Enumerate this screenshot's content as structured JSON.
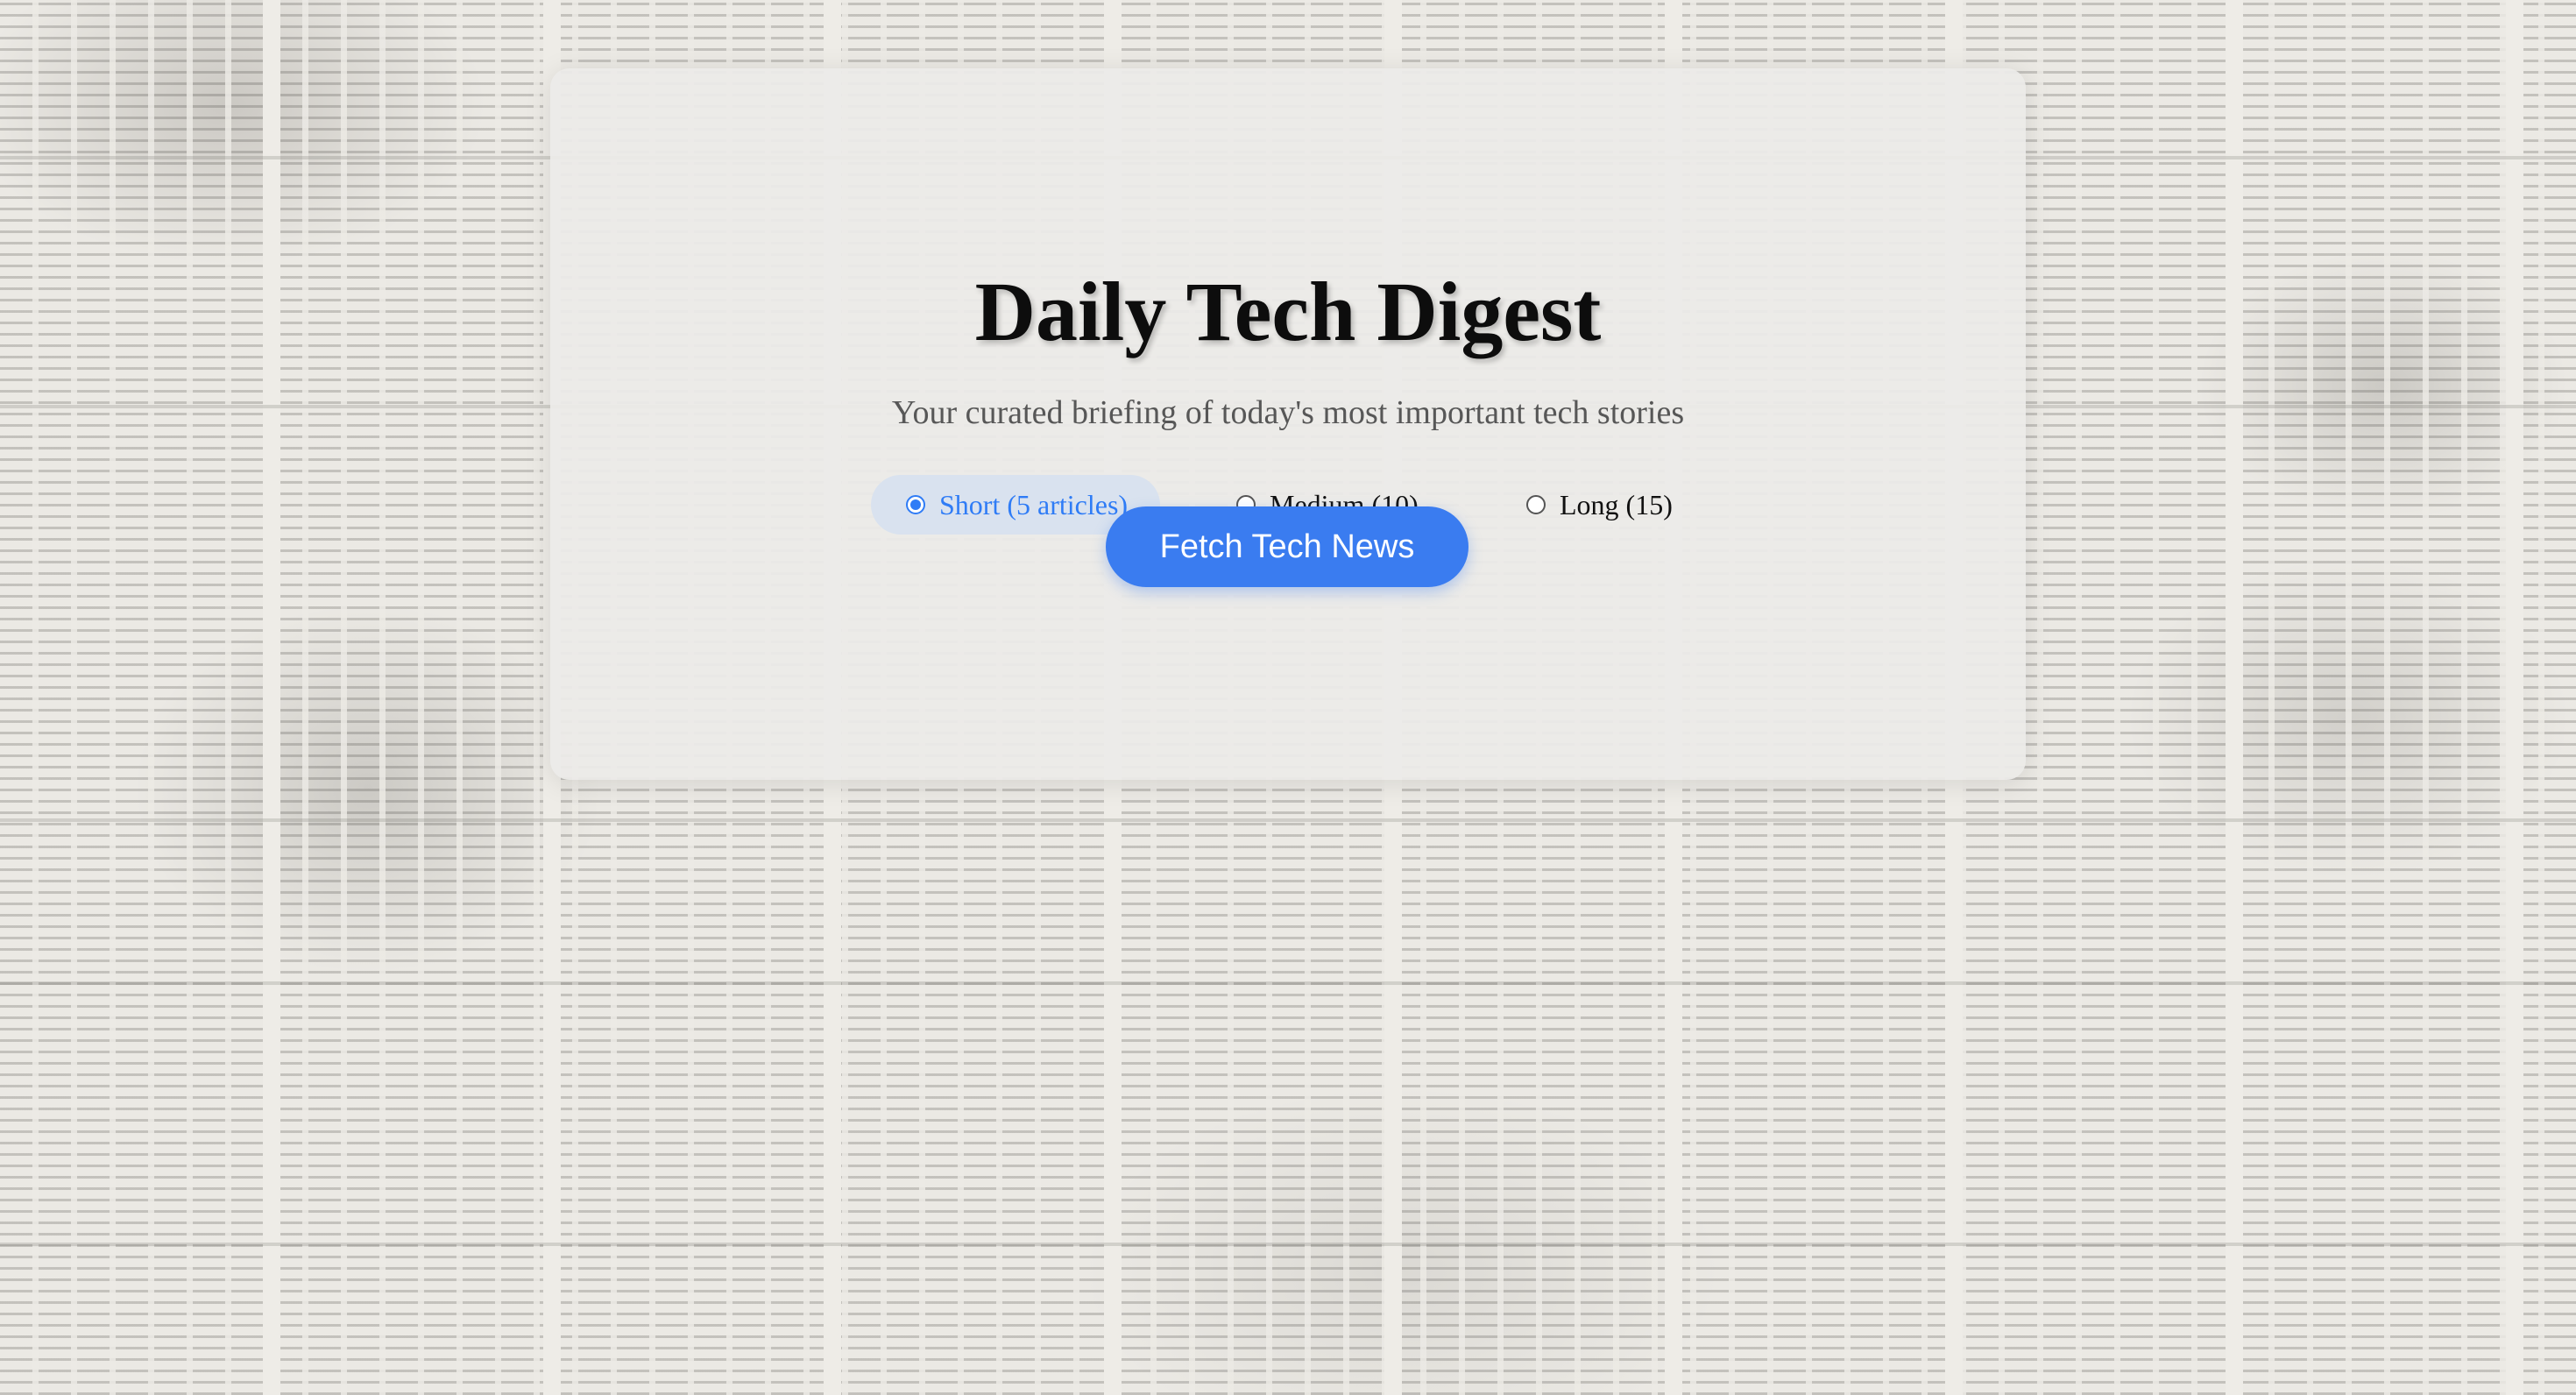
{
  "header": {
    "title": "Daily Tech Digest",
    "subtitle": "Your curated briefing of today's most important tech stories"
  },
  "length_options": [
    {
      "label": "Short (5 articles)",
      "selected": true
    },
    {
      "label": "Medium (10)",
      "selected": false
    },
    {
      "label": "Long (15)",
      "selected": false
    }
  ],
  "actions": {
    "fetch_label": "Fetch Tech News"
  },
  "colors": {
    "accent": "#3a7cf0",
    "selected_bg": "#d9e2ef",
    "title": "#0d0d0d",
    "subtitle": "#575757"
  }
}
